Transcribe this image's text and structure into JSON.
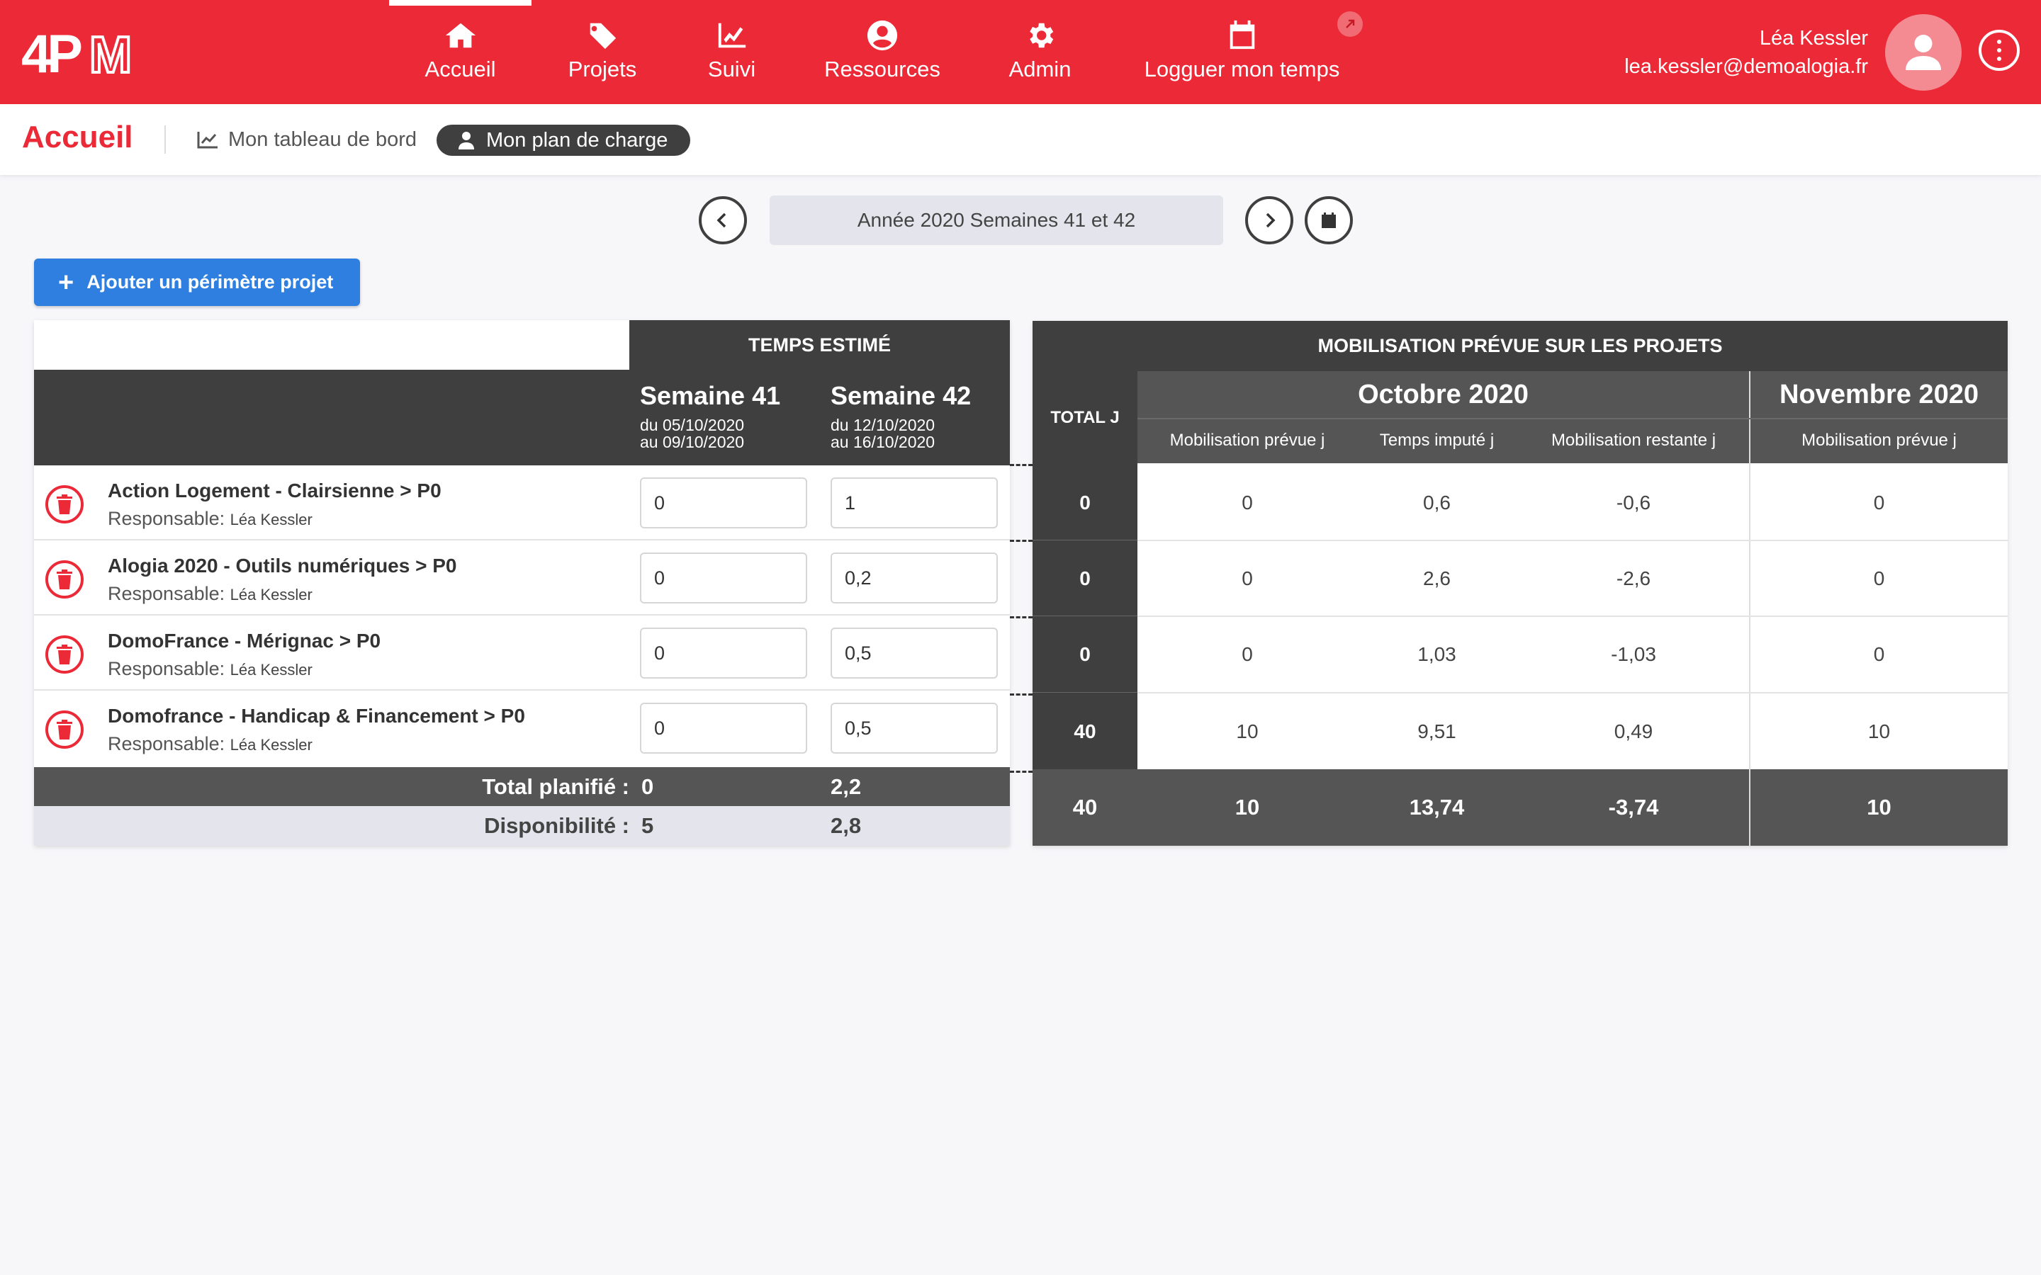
{
  "app": {
    "logo_text": "4PM",
    "nav": [
      {
        "label": "Accueil",
        "icon": "home-icon"
      },
      {
        "label": "Projets",
        "icon": "tag-icon"
      },
      {
        "label": "Suivi",
        "icon": "chart-icon"
      },
      {
        "label": "Ressources",
        "icon": "user-circle-icon"
      },
      {
        "label": "Admin",
        "icon": "gear-icon"
      },
      {
        "label": "Logguer mon temps",
        "icon": "calendar-icon"
      }
    ],
    "active_nav": "Accueil",
    "user": {
      "name": "Léa Kessler",
      "email": "lea.kessler@demoalogia.fr"
    },
    "colors": {
      "brand": "#ec2a37",
      "dark": "#3f3f3f",
      "primary_button": "#2f7fe0"
    }
  },
  "subheader": {
    "title": "Accueil",
    "tab_dashboard": "Mon tableau de bord",
    "tab_plan": "Mon plan de charge"
  },
  "period": {
    "label": "Année 2020 Semaines 41 et 42"
  },
  "add_button": "Ajouter un périmètre projet",
  "left_table": {
    "section_title": "TEMPS ESTIMÉ",
    "weeks": [
      {
        "title": "Semaine 41",
        "from": "du 05/10/2020",
        "to": "au 09/10/2020"
      },
      {
        "title": "Semaine 42",
        "from": "du 12/10/2020",
        "to": "au 16/10/2020"
      }
    ],
    "resp_label": "Responsable:",
    "rows": [
      {
        "project": "Action Logement - Clairsienne > P0",
        "responsable": "Léa Kessler",
        "w41": "0",
        "w42": "1"
      },
      {
        "project": "Alogia 2020 - Outils numériques > P0",
        "responsable": "Léa Kessler",
        "w41": "0",
        "w42": "0,2"
      },
      {
        "project": "DomoFrance - Mérignac > P0",
        "responsable": "Léa Kessler",
        "w41": "0",
        "w42": "0,5"
      },
      {
        "project": "Domofrance - Handicap & Financement > P0",
        "responsable": "Léa Kessler",
        "w41": "0",
        "w42": "0,5"
      }
    ],
    "total": {
      "label": "Total planifié :",
      "w41": "0",
      "w42": "2,2"
    },
    "dispo": {
      "label": "Disponibilité :",
      "w41": "5",
      "w42": "2,8"
    }
  },
  "right_table": {
    "section_title": "MOBILISATION PRÉVUE SUR LES PROJETS",
    "total_j_label": "TOTAL J",
    "months": [
      {
        "title": "Octobre 2020",
        "columns": [
          "Mobilisation prévue j",
          "Temps imputé j",
          "Mobilisation restante j"
        ]
      },
      {
        "title": "Novembre 2020",
        "columns": [
          "Mobilisation prévue j"
        ]
      }
    ],
    "rows": [
      {
        "total_j": "0",
        "oct_prevue": "0",
        "oct_impute": "0,6",
        "oct_restante": "-0,6",
        "nov_prevue": "0"
      },
      {
        "total_j": "0",
        "oct_prevue": "0",
        "oct_impute": "2,6",
        "oct_restante": "-2,6",
        "nov_prevue": "0"
      },
      {
        "total_j": "0",
        "oct_prevue": "0",
        "oct_impute": "1,03",
        "oct_restante": "-1,03",
        "nov_prevue": "0"
      },
      {
        "total_j": "40",
        "oct_prevue": "10",
        "oct_impute": "9,51",
        "oct_restante": "0,49",
        "nov_prevue": "10"
      }
    ],
    "totals": {
      "total_j": "40",
      "oct_prevue": "10",
      "oct_impute": "13,74",
      "oct_restante": "-3,74",
      "nov_prevue": "10"
    }
  }
}
